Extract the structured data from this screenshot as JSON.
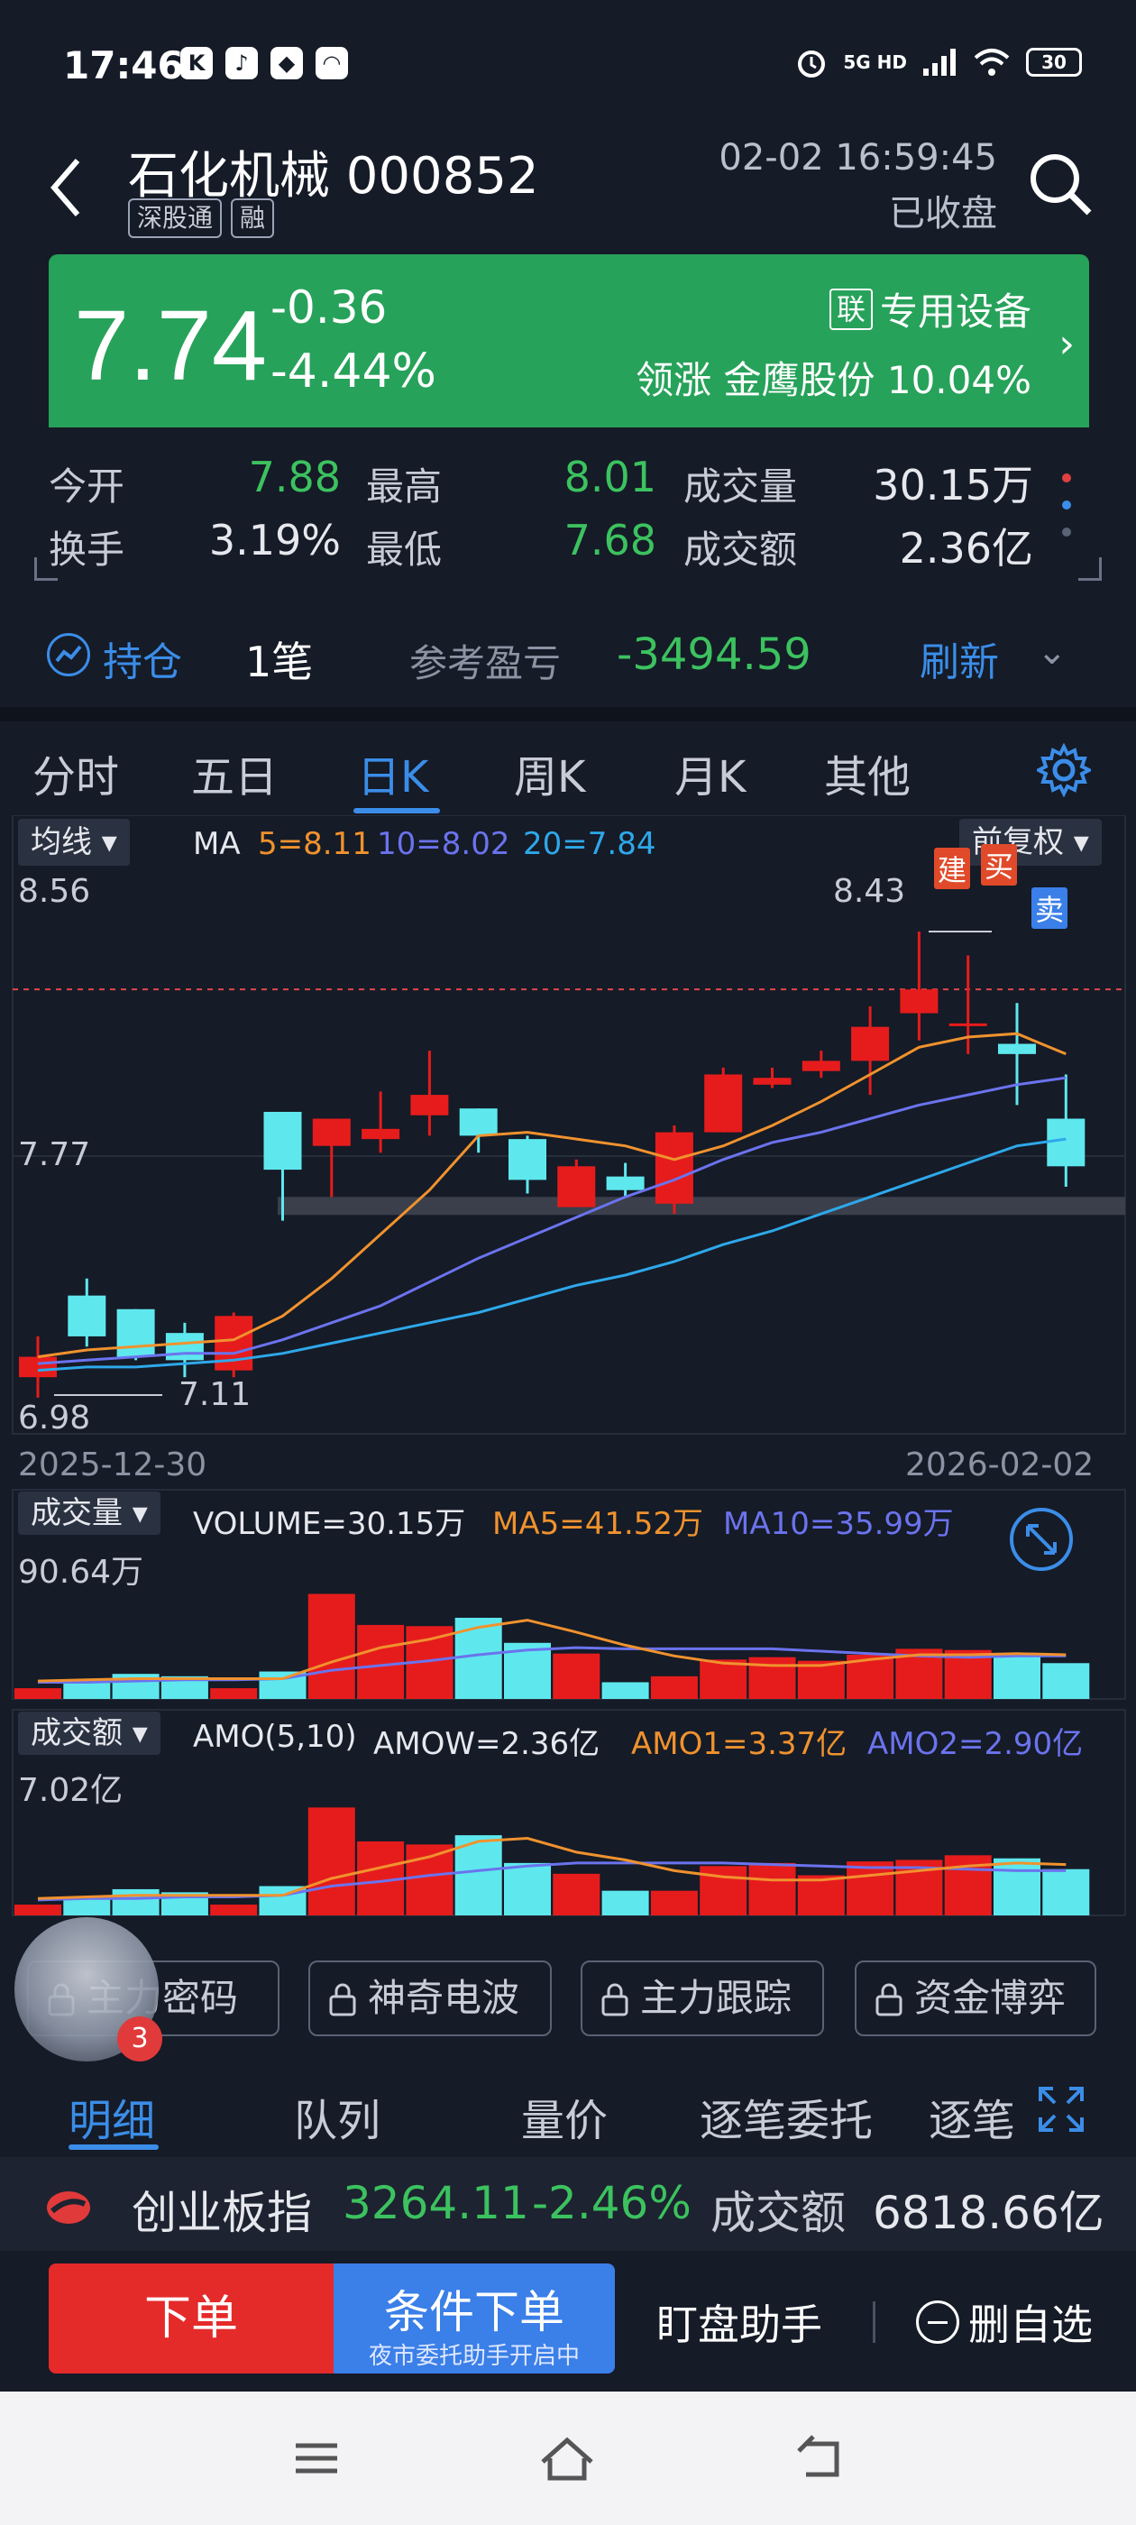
{
  "status_bar": {
    "time": "17:46",
    "apps": [
      "K",
      "♪",
      "◆",
      "◠"
    ],
    "network": "5G HD",
    "battery": "30"
  },
  "header": {
    "stock_name": "石化机械 000852",
    "tags": [
      "深股通",
      "融"
    ],
    "datetime": "02-02 16:59:45",
    "market_status": "已收盘"
  },
  "price": {
    "last": "7.74",
    "change": "-0.36",
    "change_pct": "-4.44%",
    "sector_tag": "联",
    "sector": "专用设备",
    "leader_label": "领涨",
    "leader_name": "金鹰股份",
    "leader_pct": "10.04%",
    "bg_color": "#27a25a"
  },
  "stats": {
    "open_label": "今开",
    "open": "7.88",
    "high_label": "最高",
    "high": "8.01",
    "volume_label": "成交量",
    "volume": "30.15万",
    "turnover_label": "换手",
    "turnover": "3.19%",
    "low_label": "最低",
    "low": "7.68",
    "amount_label": "成交额",
    "amount": "2.36亿"
  },
  "position": {
    "label": "持仓",
    "count": "1笔",
    "pnl_label": "参考盈亏",
    "pnl": "-3494.59",
    "refresh": "刷新"
  },
  "tabs": [
    "分时",
    "五日",
    "日K",
    "周K",
    "月K",
    "其他"
  ],
  "active_tab": "日K",
  "kline": {
    "indicator_dropdown": "均线",
    "ma_label": "MA",
    "ma5": "5=8.11",
    "ma10": "10=8.02",
    "ma20": "20=7.84",
    "adjust_dropdown": "前复权",
    "y_top": "8.56",
    "y_mid": "7.77",
    "y_bottom": "6.98",
    "high_mark": "8.43",
    "low_mark": "7.11",
    "marker_build": "建",
    "marker_buy": "买",
    "marker_sell": "卖",
    "date_start": "2025-12-30",
    "date_end": "2026-02-02",
    "colors": {
      "up": "#e61c1c",
      "down": "#5ee8ee",
      "ma5": "#f0922e",
      "ma10": "#6b73ee",
      "ma20": "#2ea8ea"
    }
  },
  "volume_panel": {
    "dropdown": "成交量",
    "volume": "VOLUME=30.15万",
    "ma5": "MA5=41.52万",
    "ma10": "MA10=35.99万",
    "y_top": "90.64万"
  },
  "amount_panel": {
    "dropdown": "成交额",
    "label": "AMO(5,10)",
    "amow": "AMOW=2.36亿",
    "amo1": "AMO1=3.37亿",
    "amo2": "AMO2=2.90亿",
    "y_top": "7.02亿"
  },
  "chart_data": [
    {
      "type": "candlestick",
      "title": "",
      "x_range": [
        "2025-12-30",
        "2026-02-02"
      ],
      "ylim": [
        6.98,
        8.56
      ],
      "candles": [
        {
          "o": 7.12,
          "h": 7.24,
          "l": 7.06,
          "c": 7.18
        },
        {
          "o": 7.36,
          "h": 7.41,
          "l": 7.21,
          "c": 7.24
        },
        {
          "o": 7.32,
          "h": 7.32,
          "l": 7.17,
          "c": 7.18
        },
        {
          "o": 7.25,
          "h": 7.28,
          "l": 7.12,
          "c": 7.17
        },
        {
          "o": 7.14,
          "h": 7.31,
          "l": 7.12,
          "c": 7.3
        },
        {
          "o": 7.9,
          "h": 7.9,
          "l": 7.58,
          "c": 7.73
        },
        {
          "o": 7.8,
          "h": 7.85,
          "l": 7.65,
          "c": 7.88
        },
        {
          "o": 7.82,
          "h": 7.96,
          "l": 7.78,
          "c": 7.85
        },
        {
          "o": 7.89,
          "h": 8.08,
          "l": 7.83,
          "c": 7.95
        },
        {
          "o": 7.91,
          "h": 7.91,
          "l": 7.78,
          "c": 7.83
        },
        {
          "o": 7.82,
          "h": 7.83,
          "l": 7.66,
          "c": 7.7
        },
        {
          "o": 7.62,
          "h": 7.76,
          "l": 7.62,
          "c": 7.74
        },
        {
          "o": 7.71,
          "h": 7.75,
          "l": 7.65,
          "c": 7.67
        },
        {
          "o": 7.63,
          "h": 7.86,
          "l": 7.6,
          "c": 7.84
        },
        {
          "o": 7.84,
          "h": 8.03,
          "l": 7.84,
          "c": 8.01
        },
        {
          "o": 7.98,
          "h": 8.03,
          "l": 7.97,
          "c": 8.0
        },
        {
          "o": 8.02,
          "h": 8.08,
          "l": 8.0,
          "c": 8.05
        },
        {
          "o": 8.05,
          "h": 8.21,
          "l": 7.95,
          "c": 8.15
        },
        {
          "o": 8.19,
          "h": 8.43,
          "l": 8.11,
          "c": 8.26
        },
        {
          "o": 8.16,
          "h": 8.36,
          "l": 8.07,
          "c": 8.16
        },
        {
          "o": 8.1,
          "h": 8.22,
          "l": 7.92,
          "c": 8.07
        },
        {
          "o": 7.88,
          "h": 8.01,
          "l": 7.68,
          "c": 7.74
        }
      ],
      "ma5": [
        7.18,
        7.2,
        7.21,
        7.22,
        7.23,
        7.3,
        7.41,
        7.54,
        7.67,
        7.83,
        7.84,
        7.82,
        7.8,
        7.76,
        7.8,
        7.86,
        7.93,
        8.01,
        8.09,
        8.12,
        8.13,
        8.07
      ],
      "ma10": [
        7.16,
        7.17,
        7.18,
        7.19,
        7.19,
        7.23,
        7.28,
        7.33,
        7.4,
        7.47,
        7.53,
        7.59,
        7.65,
        7.7,
        7.76,
        7.81,
        7.84,
        7.88,
        7.92,
        7.95,
        7.98,
        8.0
      ],
      "ma20": [
        7.14,
        7.15,
        7.15,
        7.16,
        7.17,
        7.19,
        7.22,
        7.25,
        7.28,
        7.31,
        7.35,
        7.39,
        7.42,
        7.46,
        7.51,
        7.55,
        7.6,
        7.65,
        7.7,
        7.75,
        7.8,
        7.82
      ]
    },
    {
      "type": "bar",
      "title": "",
      "ylim": [
        0,
        90.64
      ],
      "values": [
        9,
        14,
        21,
        19,
        9,
        23,
        88,
        62,
        61,
        68,
        47,
        38,
        14,
        19,
        33,
        35,
        32,
        37,
        42,
        41,
        38,
        30
      ],
      "ma5": [
        15,
        16,
        17,
        17,
        17,
        17,
        31,
        43,
        50,
        60,
        66,
        56,
        45,
        36,
        30,
        28,
        28,
        33,
        37,
        37,
        38,
        37
      ],
      "ma10": [
        14,
        14,
        15,
        16,
        16,
        17,
        24,
        28,
        32,
        37,
        41,
        43,
        42,
        42,
        42,
        42,
        40,
        38,
        36,
        35,
        36,
        36
      ]
    },
    {
      "type": "bar",
      "title": "",
      "ylim": [
        0,
        7.02
      ],
      "values": [
        0.7,
        1.1,
        1.7,
        1.5,
        0.7,
        1.9,
        7.0,
        4.8,
        4.6,
        5.2,
        3.4,
        2.7,
        1.6,
        1.6,
        3.2,
        3.4,
        2.6,
        3.5,
        3.6,
        3.9,
        3.7,
        3.0
      ],
      "ma5": [
        1.1,
        1.2,
        1.3,
        1.3,
        1.3,
        1.3,
        2.4,
        3.1,
        3.8,
        4.8,
        5.0,
        4.1,
        3.6,
        2.9,
        2.5,
        2.3,
        2.3,
        2.6,
        2.9,
        3.2,
        3.4,
        3.3
      ],
      "ma10": [
        1.0,
        1.1,
        1.1,
        1.2,
        1.2,
        1.3,
        1.9,
        2.2,
        2.6,
        2.9,
        3.2,
        3.4,
        3.4,
        3.4,
        3.4,
        3.3,
        3.2,
        3.1,
        3.1,
        3.0,
        2.9,
        2.9
      ]
    }
  ],
  "chips": [
    "主力密码",
    "神奇电波",
    "主力跟踪",
    "资金博弈"
  ],
  "avatar_badge": "3",
  "detail_tabs": [
    "明细",
    "队列",
    "量价",
    "逐笔委托",
    "逐笔"
  ],
  "index": {
    "name": "创业板指",
    "value": "3264.11",
    "change_pct": "-2.46%",
    "amount_label": "成交额",
    "amount": "6818.66亿"
  },
  "actions": {
    "order": "下单",
    "conditional": "条件下单",
    "conditional_sub": "夜市委托助手开启中",
    "assistant": "盯盘助手",
    "remove": "删自选"
  }
}
